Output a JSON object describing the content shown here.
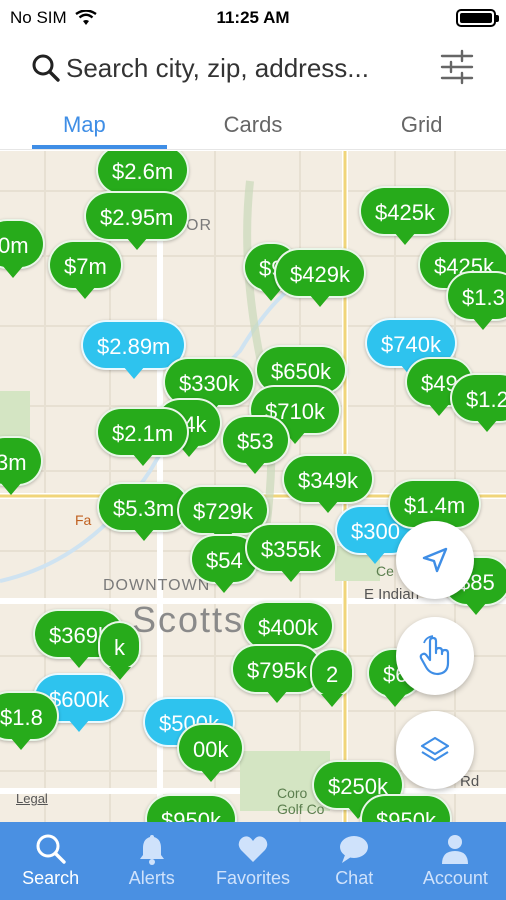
{
  "status": {
    "carrier": "No SIM",
    "time": "11:25 AM"
  },
  "search": {
    "placeholder": "Search city, zip, address..."
  },
  "tabs": [
    {
      "label": "Map",
      "active": true
    },
    {
      "label": "Cards",
      "active": false
    },
    {
      "label": "Grid",
      "active": false
    }
  ],
  "map": {
    "labels": {
      "downtown": "DOWNTOWN",
      "city": "Scotts",
      "or": "OR",
      "indian": "E Indian",
      "golf": "Coro Golf Co",
      "rd": "Rd",
      "fa": "Fa",
      "ce": "Ce",
      "tail": "l",
      "legal": "Legal"
    },
    "pins": [
      {
        "price": "$2.6m",
        "color": "green"
      },
      {
        "price": "$2.95m",
        "color": "green"
      },
      {
        "price": "$425k",
        "color": "green"
      },
      {
        "price": "0m",
        "color": "green"
      },
      {
        "price": "$7m",
        "color": "green"
      },
      {
        "price": "$9",
        "color": "green"
      },
      {
        "price": "$429k",
        "color": "green"
      },
      {
        "price": "$425k",
        "color": "green"
      },
      {
        "price": "$1.3",
        "color": "green"
      },
      {
        "price": "$2.89m",
        "color": "blue"
      },
      {
        "price": "$740k",
        "color": "blue"
      },
      {
        "price": "$330k",
        "color": "green"
      },
      {
        "price": "$650k",
        "color": "green"
      },
      {
        "price": "$49",
        "color": "green"
      },
      {
        "price": "$1.2",
        "color": "green"
      },
      {
        "price": "24k",
        "color": "green"
      },
      {
        "price": "$710k",
        "color": "green"
      },
      {
        "price": "$2.1m",
        "color": "green"
      },
      {
        "price": "$53",
        "color": "green"
      },
      {
        "price": "3m",
        "color": "green"
      },
      {
        "price": "$349k",
        "color": "green"
      },
      {
        "price": "$5.3m",
        "color": "green"
      },
      {
        "price": "$729k",
        "color": "green"
      },
      {
        "price": "$300",
        "color": "blue"
      },
      {
        "price": "$1.4m",
        "color": "green"
      },
      {
        "price": "$54",
        "color": "green"
      },
      {
        "price": "$355k",
        "color": "green"
      },
      {
        "price": "$85",
        "color": "green"
      },
      {
        "price": "$369k",
        "color": "green"
      },
      {
        "price": "k",
        "color": "green"
      },
      {
        "price": "$400k",
        "color": "green"
      },
      {
        "price": "$795k",
        "color": "green"
      },
      {
        "price": "2",
        "color": "green"
      },
      {
        "price": "$6",
        "color": "green"
      },
      {
        "price": "$600k",
        "color": "blue"
      },
      {
        "price": "$1.8",
        "color": "green"
      },
      {
        "price": "$500k",
        "color": "blue"
      },
      {
        "price": "00k",
        "color": "green"
      },
      {
        "price": "$250k",
        "color": "green"
      },
      {
        "price": "$950k",
        "color": "green"
      },
      {
        "price": "$950k",
        "color": "green"
      }
    ]
  },
  "nav": [
    {
      "label": "Search",
      "icon": "search-icon",
      "active": true
    },
    {
      "label": "Alerts",
      "icon": "bell-icon",
      "active": false
    },
    {
      "label": "Favorites",
      "icon": "heart-icon",
      "active": false
    },
    {
      "label": "Chat",
      "icon": "chat-icon",
      "active": false
    },
    {
      "label": "Account",
      "icon": "person-icon",
      "active": false
    }
  ]
}
